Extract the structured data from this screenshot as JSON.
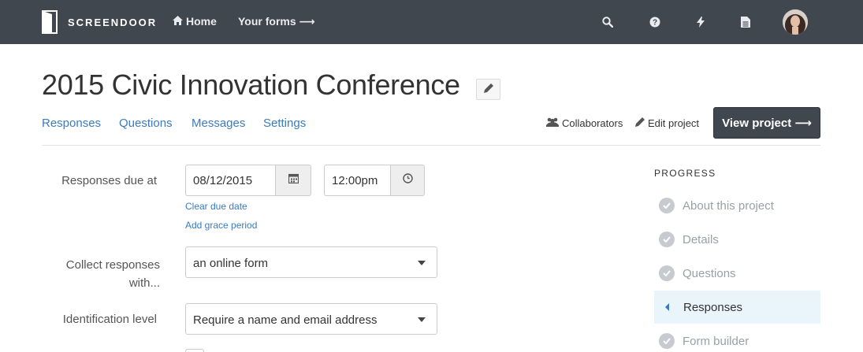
{
  "app": {
    "name": "SCREENDOOR"
  },
  "nav": {
    "home_label": "Home",
    "forms_label": "Your forms ⟶",
    "icons": [
      "search-icon",
      "help-icon",
      "bolt-icon",
      "document-icon"
    ]
  },
  "project": {
    "title": "2015 Civic Innovation Conference",
    "tabs": [
      "Responses",
      "Questions",
      "Messages",
      "Settings"
    ],
    "collaborators_label": "Collaborators",
    "edit_label": "Edit project",
    "view_label": "View project ⟶"
  },
  "form": {
    "due_label": "Responses due at",
    "due_date": "08/12/2015",
    "due_time": "12:00pm",
    "clear_due_label": "Clear due date",
    "grace_label": "Add grace period",
    "collect_label": "Collect responses with...",
    "collect_value": "an online form",
    "ident_label": "Identification level",
    "ident_value": "Require a name and email address"
  },
  "progress": {
    "title": "PROGRESS",
    "steps": [
      "About this project",
      "Details",
      "Questions",
      "Responses",
      "Form builder"
    ],
    "active_step": "Responses"
  },
  "colors": {
    "topbar": "#41474f",
    "link": "#3a7bbf",
    "active_step_bg": "#eaf4fb"
  }
}
